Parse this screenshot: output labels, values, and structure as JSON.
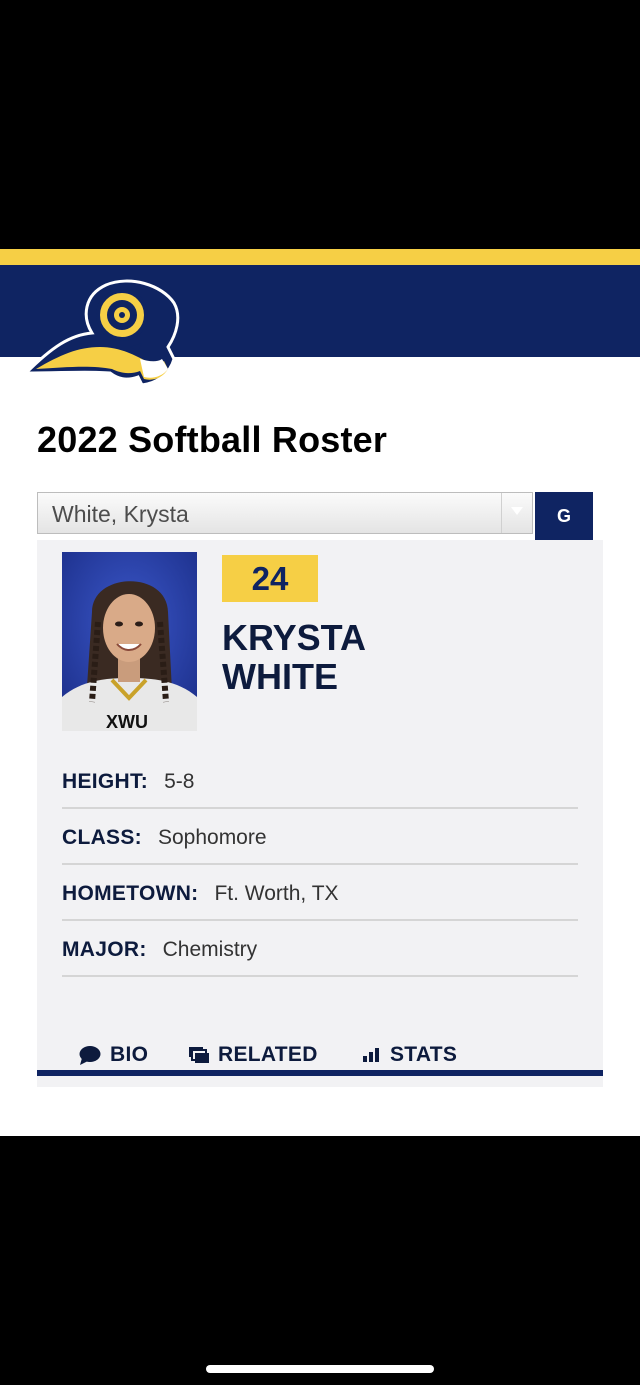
{
  "roster": {
    "title": "2022 Softball Roster",
    "selected_player": "White, Krysta",
    "go_label": "G"
  },
  "player": {
    "number": "24",
    "first_name": "KRYSTA",
    "last_name": "WHITE",
    "details": [
      {
        "label": "HEIGHT:",
        "value": "5-8"
      },
      {
        "label": "CLASS:",
        "value": "Sophomore"
      },
      {
        "label": "HOMETOWN:",
        "value": "Ft. Worth, TX"
      },
      {
        "label": "MAJOR:",
        "value": "Chemistry"
      }
    ]
  },
  "tabs": {
    "bio": "BIO",
    "related": "RELATED",
    "stats": "STATS"
  },
  "icons": {
    "logo": "ram-logo-icon",
    "bio": "speech-bubble-icon",
    "related": "stacked-cards-icon",
    "stats": "bar-chart-icon"
  },
  "colors": {
    "navy": "#0f2462",
    "gold": "#f6cf45"
  }
}
